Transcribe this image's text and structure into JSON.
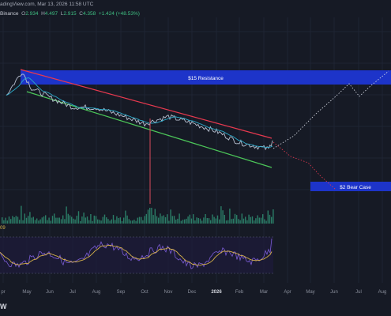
{
  "header": {
    "source": "adingView.com, Mar 13, 2026 11:58 UTC",
    "exchange": "Binance",
    "o_label": "O",
    "o_val": "2.934",
    "h_label": "H",
    "h_val": "4.497",
    "l_label": "L",
    "l_val": "2.915",
    "c_label": "C",
    "c_val": "4.358",
    "change": "+1.424 (+48.53%)"
  },
  "indicator_label": "09",
  "brand": "W",
  "colors": {
    "background": "#161a25",
    "resistance_box": "#1d34c9",
    "bear_box": "#1d34c9",
    "upper_line": "#e8394f",
    "lower_line": "#4cc759",
    "price_line": "#b8c0d0",
    "ma_line": "#2aa9c9",
    "rsi_line": "#7b5cd6",
    "rsi_ma": "#d6b14a",
    "volume": "#2f8f73"
  },
  "chart_data": {
    "type": "line",
    "x_tick_labels": [
      "pr",
      "May",
      "Jun",
      "Jul",
      "Aug",
      "Sep",
      "Oct",
      "Nov",
      "Dec",
      "2026",
      "Feb",
      "Mar",
      "Apr",
      "May",
      "Jun",
      "Jul",
      "Aug"
    ],
    "annotations": [
      {
        "label": "$15 Resistance"
      },
      {
        "label": "$2 Bear Case"
      }
    ],
    "price_series": [
      {
        "month": "Apr",
        "value": 12.0
      },
      {
        "month": "May",
        "value": 16.0
      },
      {
        "month": "May",
        "value": 13.2
      },
      {
        "month": "Jun",
        "value": 11.6
      },
      {
        "month": "Jul",
        "value": 10.0
      },
      {
        "month": "Aug",
        "value": 9.9
      },
      {
        "month": "Sep",
        "value": 8.6
      },
      {
        "month": "Oct",
        "value": 7.2
      },
      {
        "month": "Nov",
        "value": 8.4
      },
      {
        "month": "Dec",
        "value": 7.3
      },
      {
        "month": "2026",
        "value": 5.9
      },
      {
        "month": "Feb",
        "value": 4.0
      },
      {
        "month": "Mar",
        "value": 2.9
      },
      {
        "month": "Mar",
        "value": 4.36
      }
    ],
    "scenarios": [
      {
        "name": "bull",
        "style": "dotted",
        "target": "$15 Resistance"
      },
      {
        "name": "bear",
        "style": "dotted",
        "target": "$2 Bear Case"
      }
    ],
    "grid": true
  }
}
